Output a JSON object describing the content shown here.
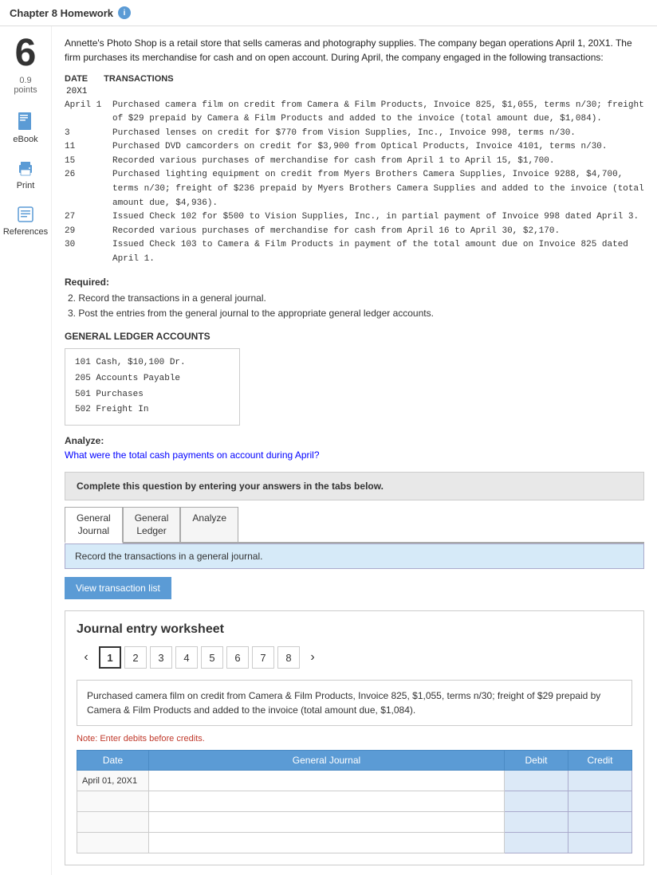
{
  "header": {
    "title": "Chapter 8 Homework",
    "info_icon": "i"
  },
  "sidebar": {
    "problem_number": "6",
    "points": "0.9",
    "points_label": "points",
    "ebook_label": "eBook",
    "print_label": "Print",
    "references_label": "References"
  },
  "problem": {
    "description": "Annette's Photo Shop is a retail store that sells cameras and photography supplies. The company began operations April 1, 20X1. The firm purchases its merchandise for cash and on open account. During April, the company engaged in the following transactions:",
    "trans_header_date": "DATE",
    "trans_header_transactions": "TRANSACTIONS",
    "year": "20X1",
    "transactions": [
      {
        "date": "April 1",
        "text": "Purchased camera film on credit from Camera & Film Products, Invoice 825, $1,055, terms n/30; freight of $29 prepaid by Camera & Film Products and added to the invoice (total amount due, $1,084)."
      },
      {
        "date": "3",
        "text": "Purchased lenses on credit for $770 from Vision Supplies, Inc., Invoice 998, terms n/30."
      },
      {
        "date": "11",
        "text": "Purchased DVD camcorders on credit for $3,900 from Optical Products, Invoice 4101, terms n/30."
      },
      {
        "date": "15",
        "text": "Recorded various purchases of merchandise for cash from April 1 to April 15, $1,700."
      },
      {
        "date": "26",
        "text": "Purchased lighting equipment on credit from Myers Brothers Camera Supplies, Invoice 9288, $4,700, terms n/30; freight of $236 prepaid by Myers Brothers Camera Supplies and added to the invoice (total amount due, $4,936)."
      },
      {
        "date": "27",
        "text": "Issued Check 102 for $500 to Vision Supplies, Inc., in partial payment of Invoice 998 dated April 3."
      },
      {
        "date": "29",
        "text": "Recorded various purchases of merchandise for cash from April 16 to April 30, $2,170."
      },
      {
        "date": "30",
        "text": "Issued Check 103 to Camera & Film Products in payment of the total amount due on Invoice 825 dated April 1."
      }
    ],
    "required_title": "Required:",
    "required_items": [
      "2. Record the transactions in a general journal.",
      "3. Post the entries from the general journal to the appropriate general ledger accounts."
    ],
    "gl_title": "GENERAL LEDGER ACCOUNTS",
    "gl_accounts": [
      "101  Cash, $10,100 Dr.",
      "205  Accounts Payable",
      "501  Purchases",
      "502  Freight In"
    ],
    "analyze_title": "Analyze:",
    "analyze_text": "What were the total cash payments on account during April?"
  },
  "tabs_instruction": "Complete this question by entering your answers in the tabs below.",
  "tabs": [
    {
      "label": "General\nJournal",
      "id": "general-journal",
      "active": true
    },
    {
      "label": "General\nLedger",
      "id": "general-ledger",
      "active": false
    },
    {
      "label": "Analyze",
      "id": "analyze",
      "active": false
    }
  ],
  "journal_instruction": "Record the transactions in a general journal.",
  "view_trans_btn": "View transaction list",
  "worksheet": {
    "title": "Journal entry worksheet",
    "pages": [
      "1",
      "2",
      "3",
      "4",
      "5",
      "6",
      "7",
      "8"
    ],
    "active_page": "1",
    "trans_description": "Purchased camera film on credit from Camera & Film Products, Invoice 825, $1,055, terms n/30; freight of $29 prepaid by Camera & Film Products and added to the invoice (total amount due, $1,084).",
    "note": "Note: Enter debits before credits.",
    "table": {
      "headers": [
        "Date",
        "General Journal",
        "Debit",
        "Credit"
      ],
      "rows": [
        {
          "date": "April 01, 20X1",
          "journal": "",
          "debit": "",
          "credit": ""
        },
        {
          "date": "",
          "journal": "",
          "debit": "",
          "credit": ""
        },
        {
          "date": "",
          "journal": "",
          "debit": "",
          "credit": ""
        },
        {
          "date": "",
          "journal": "",
          "debit": "",
          "credit": ""
        }
      ]
    }
  }
}
